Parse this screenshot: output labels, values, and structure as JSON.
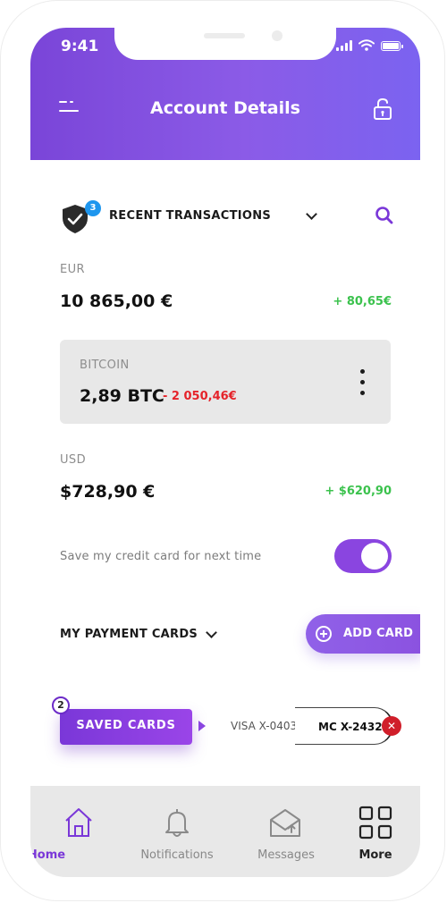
{
  "status_bar": {
    "time": "9:41"
  },
  "header": {
    "title": "Account Details"
  },
  "transactions": {
    "section_title": "RECENT TRANSACTIONS",
    "badge_count": "3",
    "accounts": [
      {
        "currency": "EUR",
        "balance": "10 865,00 €",
        "change": "+ 80,65€",
        "change_color": "#3bc24d"
      },
      {
        "currency": "BITCOIN",
        "balance": "2,89 BTC",
        "change": "- 2 050,46€",
        "change_color": "#e5232a",
        "selected": true
      },
      {
        "currency": "USD",
        "balance": "$728,90 €",
        "change": "+ $620,90",
        "change_color": "#3bc24d"
      }
    ]
  },
  "save_card": {
    "label": "Save my credit card for next time",
    "enabled": true
  },
  "payment_cards": {
    "section_title": "MY PAYMENT CARDS",
    "add_button": "ADD CARD",
    "saved_button": "SAVED CARDS",
    "saved_count": "2",
    "cards": [
      "VISA X-0403",
      "MC X-2432"
    ]
  },
  "tabbar": {
    "items": [
      {
        "label": "Home",
        "icon": "home-icon",
        "active": true
      },
      {
        "label": "Notifications",
        "icon": "bell-icon"
      },
      {
        "label": "Messages",
        "icon": "envelope-icon"
      },
      {
        "label": "More",
        "icon": "grid-icon"
      }
    ]
  },
  "colors": {
    "accent": "#8a45e0",
    "positive": "#3bc24d",
    "negative": "#e5232a",
    "badge_blue": "#1e96ee"
  }
}
